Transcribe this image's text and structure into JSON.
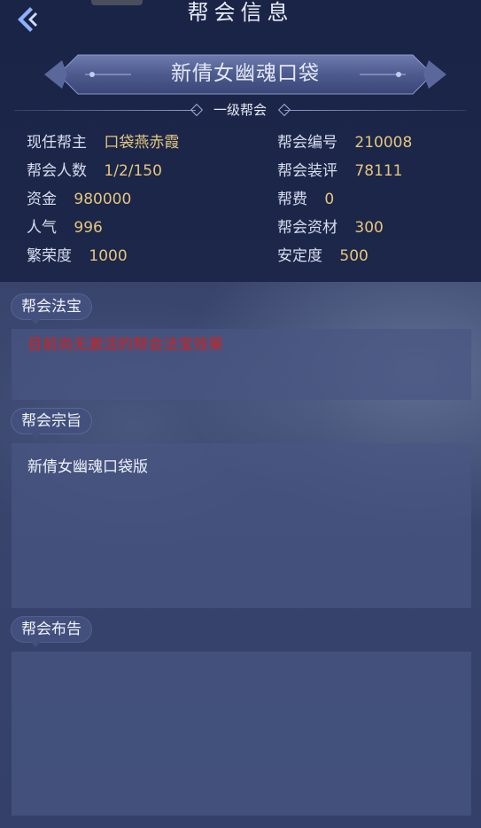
{
  "header": {
    "title": "帮会信息",
    "back_icon": "back-arrow-icon"
  },
  "guild": {
    "name": "新倩女幽魂口袋",
    "level": "一级帮会"
  },
  "stats": {
    "leader": {
      "label": "现任帮主",
      "value": "口袋燕赤霞"
    },
    "guild_id": {
      "label": "帮会编号",
      "value": "210008"
    },
    "members": {
      "label": "帮会人数",
      "value": "1/2/150"
    },
    "equipment_score": {
      "label": "帮会装评",
      "value": "78111"
    },
    "funds": {
      "label": "资金",
      "value": "980000"
    },
    "fee": {
      "label": "帮费",
      "value": "0"
    },
    "popularity": {
      "label": "人气",
      "value": "996"
    },
    "materials": {
      "label": "帮会资材",
      "value": "300"
    },
    "prosperity": {
      "label": "繁荣度",
      "value": "1000"
    },
    "stability": {
      "label": "安定度",
      "value": "500"
    }
  },
  "sections": {
    "treasure": {
      "title": "帮会法宝",
      "text": "目前尚无激活的帮会法宝效果"
    },
    "purpose": {
      "title": "帮会宗旨",
      "text": "新倩女幽魂口袋版"
    },
    "notice": {
      "title": "帮会布告",
      "text": ""
    }
  },
  "colors": {
    "value_gold": "#e5c67f",
    "warning_red": "#d31f1f",
    "panel_dark": "#1a2446",
    "tag_bg": "#43507e"
  }
}
